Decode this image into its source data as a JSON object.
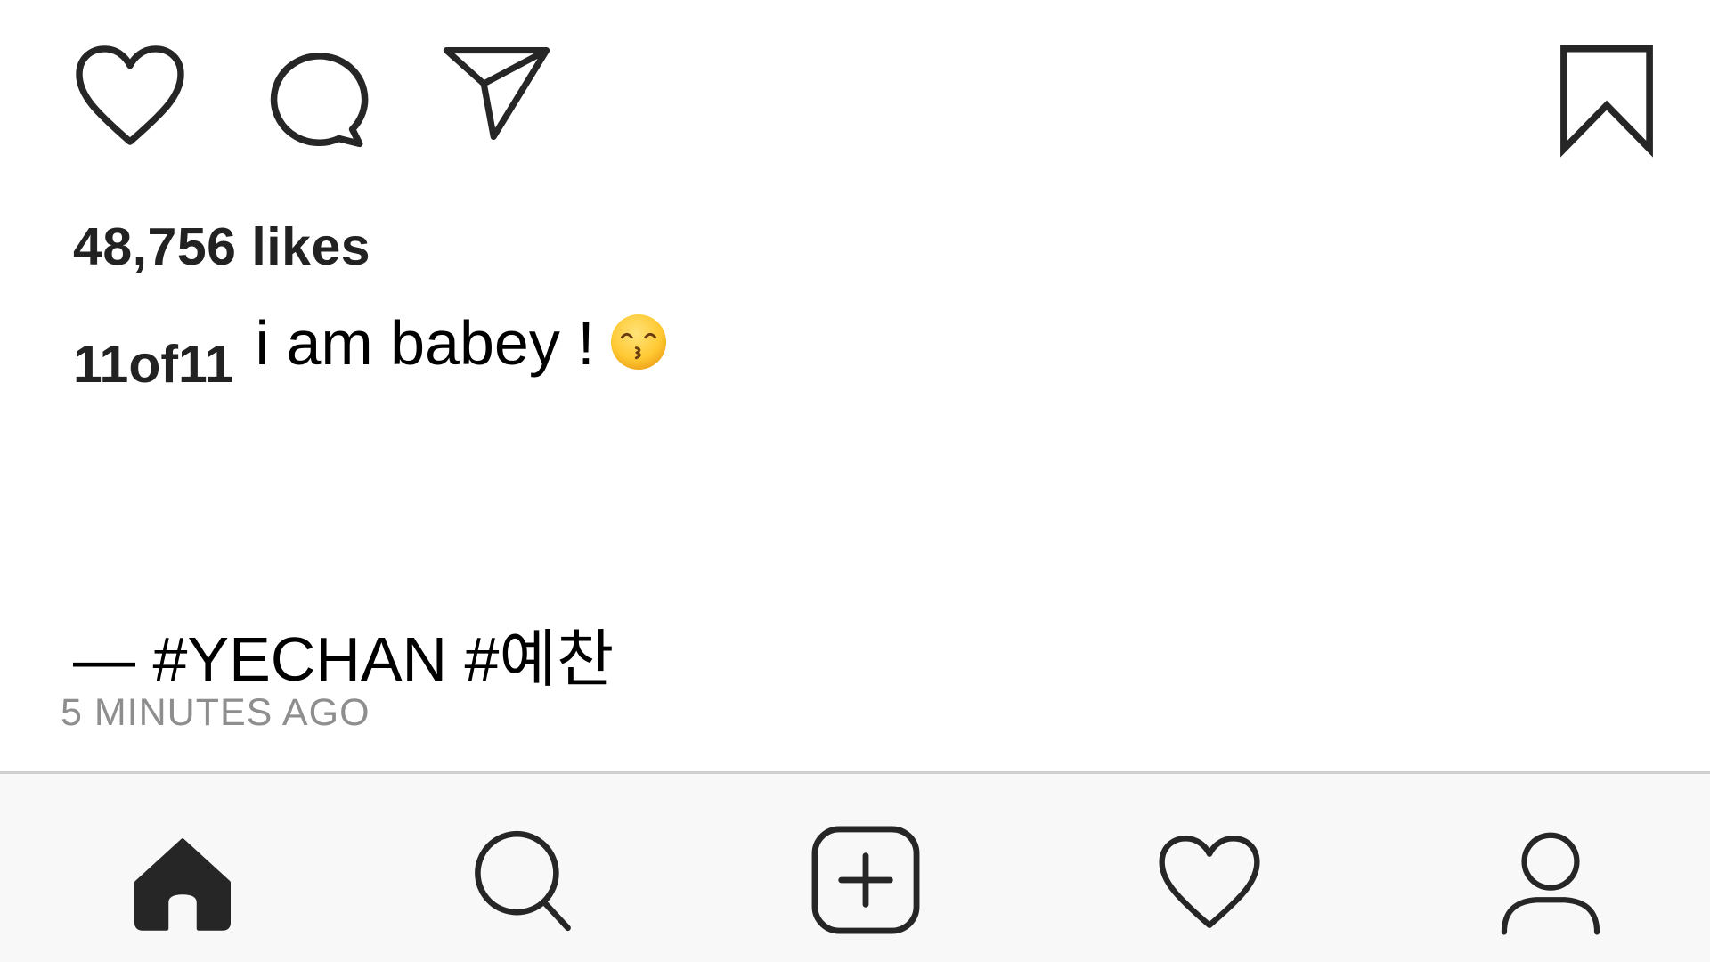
{
  "post": {
    "likes_text": "48,756 likes",
    "username": "11of11",
    "caption_text": "i am babey !",
    "caption_emoji": "kissing-face-with-smiling-eyes-icon",
    "hashtags_text": "— #YECHAN #예찬",
    "timestamp": "5 MINUTES AGO"
  },
  "action_bar": {
    "icons": [
      "heart-icon",
      "comment-icon",
      "share-icon",
      "bookmark-icon"
    ]
  },
  "bottom_nav": {
    "items": [
      "home-icon",
      "search-icon",
      "add-post-icon",
      "activity-heart-icon",
      "profile-icon"
    ],
    "active": "home-icon"
  },
  "colors": {
    "icon_stroke": "#262626",
    "timestamp": "#8e8e8e",
    "nav_background": "#f8f8f8",
    "divider": "#cfcfcf"
  }
}
